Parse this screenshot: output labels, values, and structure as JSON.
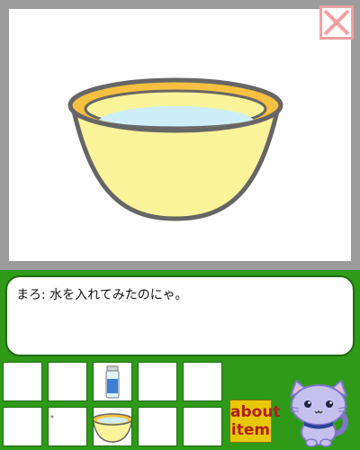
{
  "dialog": {
    "speaker": "まろ",
    "line": "まろ: 水を入れてみたのにゃ。"
  },
  "about_button": {
    "line1": "about",
    "line2": "item"
  },
  "inventory": {
    "slots": [
      {
        "item": "empty"
      },
      {
        "item": "empty"
      },
      {
        "item": "water-bottle"
      },
      {
        "item": "empty"
      },
      {
        "item": "empty"
      },
      {
        "item": "empty"
      },
      {
        "item": "empty-with-dot"
      },
      {
        "item": "water-bowl"
      },
      {
        "item": "empty"
      },
      {
        "item": "empty"
      }
    ]
  },
  "viewer": {
    "item": "water-bowl",
    "close_icon": "close-x-icon"
  },
  "colors": {
    "background": "#2e9a18",
    "frame": "#9c9c9c",
    "bowl_body": "#faf39a",
    "bowl_rim": "#f8c040",
    "water": "#cdeef8",
    "close": "#f4a0a0",
    "about_bg": "#e8c800",
    "about_text": "#b01e1e"
  }
}
